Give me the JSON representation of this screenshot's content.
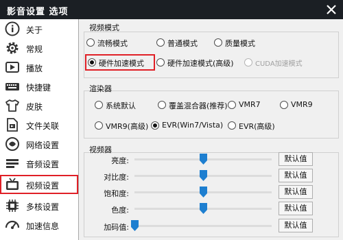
{
  "window": {
    "title": "影音设置 选项"
  },
  "sidebar": {
    "items": [
      {
        "label": "关于",
        "icon": "info-icon"
      },
      {
        "label": "常规",
        "icon": "gear-icon"
      },
      {
        "label": "播放",
        "icon": "play-icon"
      },
      {
        "label": "快捷键",
        "icon": "keyboard-icon"
      },
      {
        "label": "皮肤",
        "icon": "tshirt-icon"
      },
      {
        "label": "文件关联",
        "icon": "file-icon"
      },
      {
        "label": "网络设置",
        "icon": "network-icon"
      },
      {
        "label": "音频设置",
        "icon": "audio-icon"
      },
      {
        "label": "视频设置",
        "icon": "tv-icon",
        "selected": true
      },
      {
        "label": "多核设置",
        "icon": "cpu-icon"
      },
      {
        "label": "加速信息",
        "icon": "speedometer-icon"
      }
    ]
  },
  "video_mode": {
    "title": "视频模式",
    "options": [
      {
        "label": "流畅模式",
        "selected": false
      },
      {
        "label": "普通模式",
        "selected": false
      },
      {
        "label": "质量模式",
        "selected": false
      },
      {
        "label": "硬件加速模式",
        "selected": true
      },
      {
        "label": "硬件加速模式(高级)",
        "selected": false
      },
      {
        "label": "CUDA加速模式",
        "selected": false,
        "disabled": true
      }
    ]
  },
  "renderer": {
    "title": "渲染器",
    "options": [
      {
        "label": "系统默认",
        "selected": false
      },
      {
        "label": "覆盖混合器(推荐)",
        "selected": false
      },
      {
        "label": "VMR7",
        "selected": false
      },
      {
        "label": "VMR9",
        "selected": false
      },
      {
        "label": "VMR9(高级)",
        "selected": false
      },
      {
        "label": "EVR(Win7/Vista)",
        "selected": true
      },
      {
        "label": "EVR(高级)",
        "selected": false
      }
    ]
  },
  "video_adjust": {
    "title": "视频器",
    "default_label": "默认值",
    "sliders": [
      {
        "label": "亮度:",
        "value": 0.5
      },
      {
        "label": "对比度:",
        "value": 0.5
      },
      {
        "label": "饱和度:",
        "value": 0.5
      },
      {
        "label": "色度:",
        "value": 0.5
      },
      {
        "label": "加码值:",
        "value": 0.0
      }
    ]
  },
  "colors": {
    "highlight": "#e01f26",
    "titlebar": "#1b1f24",
    "slider_thumb": "#1e7fd0"
  }
}
